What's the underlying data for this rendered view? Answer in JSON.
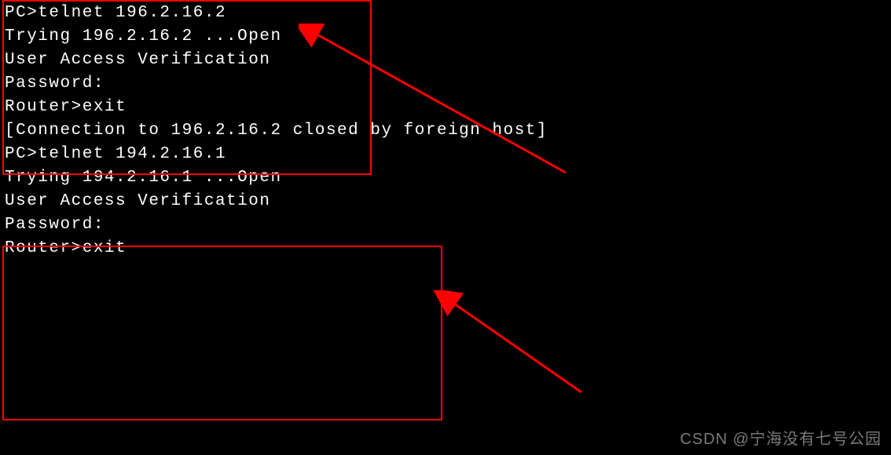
{
  "terminal": {
    "lines": [
      "PC>telnet 196.2.16.2",
      "Trying 196.2.16.2 ...Open",
      "",
      "",
      "User Access Verification",
      "",
      "Password:",
      "Router>exit",
      "",
      "[Connection to 196.2.16.2 closed by foreign host]",
      "PC>telnet 194.2.16.1",
      "Trying 194.2.16.1 ...Open",
      "",
      "",
      "User Access Verification",
      "",
      "Password:",
      "Router>exit"
    ]
  },
  "watermark": "CSDN @宁海没有七号公园",
  "annotations": {
    "box_color": "#ff0000",
    "arrow_color": "#ff0000"
  }
}
